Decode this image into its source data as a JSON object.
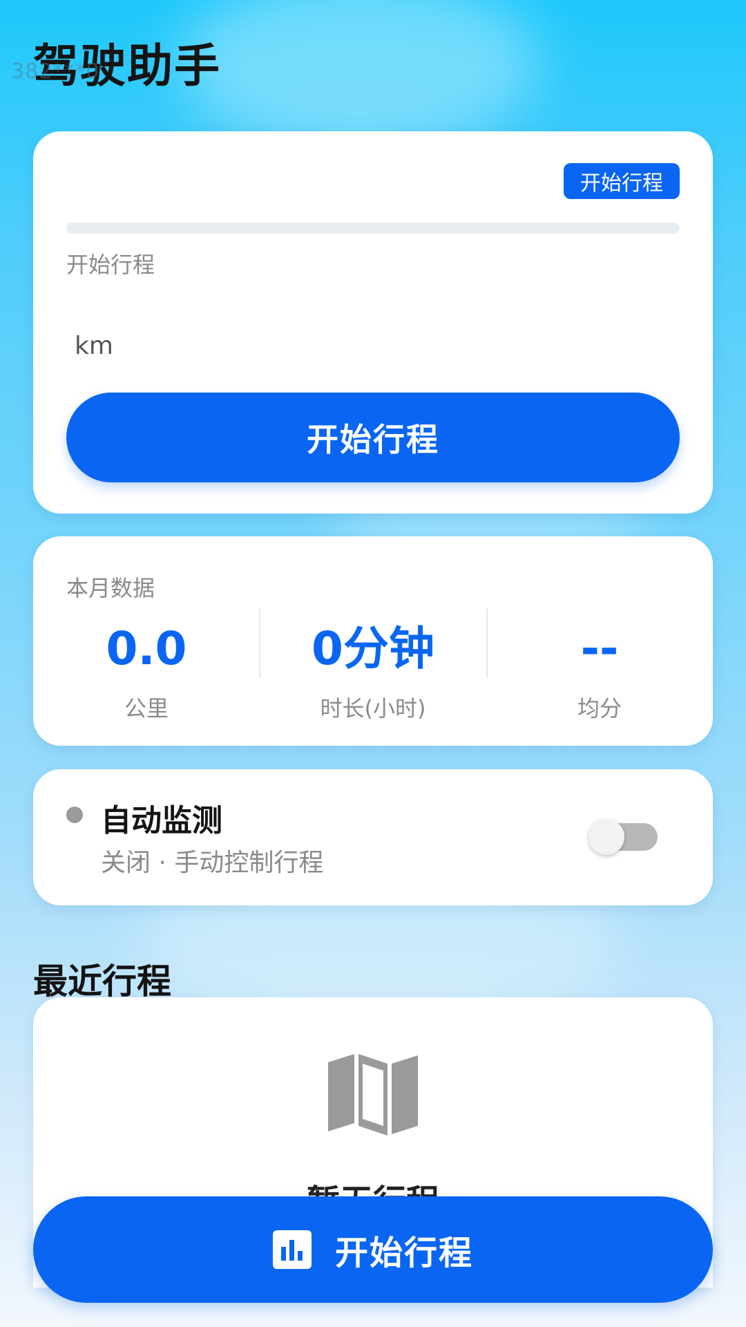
{
  "watermark": "382***0",
  "header": {
    "title": "驾驶助手"
  },
  "trip_card": {
    "badge": "开始行程",
    "progress": 0,
    "status": "开始行程",
    "unit": "km",
    "start_button": "开始行程"
  },
  "stats": {
    "label": "本月数据",
    "items": [
      {
        "value": "0.0",
        "label": "公里"
      },
      {
        "value": "0分钟",
        "label": "时长(小时)"
      },
      {
        "value": "--",
        "label": "均分"
      }
    ]
  },
  "monitor": {
    "title": "自动监测",
    "subtitle": "关闭 · 手动控制行程",
    "enabled": false
  },
  "recent": {
    "heading": "最近行程",
    "empty_text": "暂无行程"
  },
  "bottom_bar": {
    "button": "开始行程",
    "icon": "bar-chart-icon"
  },
  "colors": {
    "primary": "#0a66f2",
    "muted": "#8a8a8a"
  }
}
